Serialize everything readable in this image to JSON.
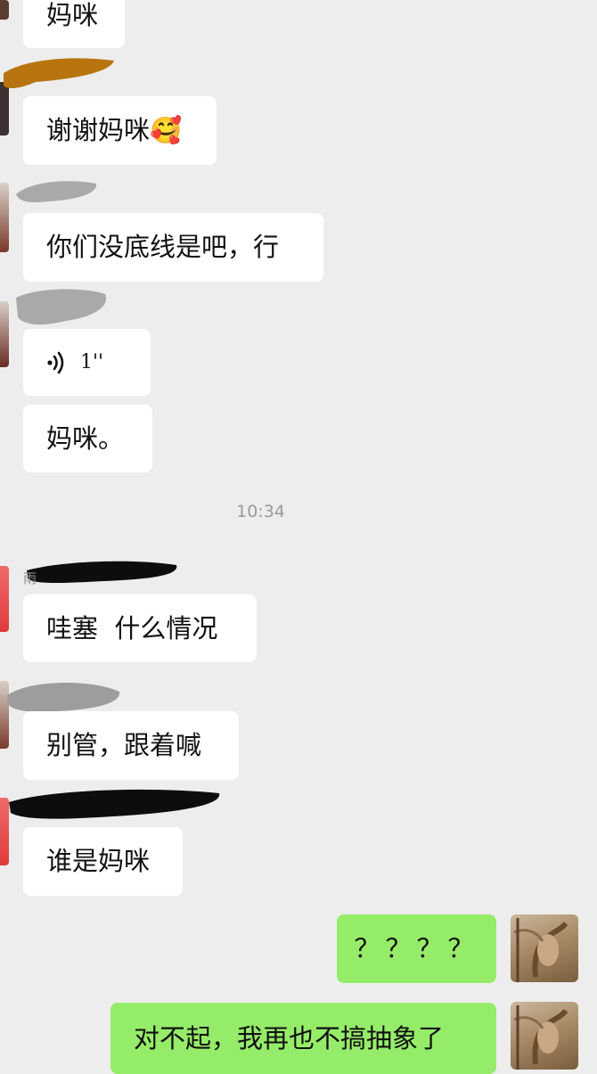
{
  "chat": {
    "messages": [
      {
        "sender": "other",
        "text": "妈咪"
      },
      {
        "sender": "other",
        "text": "谢谢妈咪🥰"
      },
      {
        "sender": "other",
        "text": "你们没底线是吧，行"
      },
      {
        "sender": "other",
        "type": "voice",
        "duration": "1''"
      },
      {
        "sender": "other",
        "text": "妈咪。"
      },
      {
        "sender": "other",
        "text": "哇塞  什么情况"
      },
      {
        "sender": "other",
        "text": "别管，跟着喊"
      },
      {
        "sender": "other",
        "text": "谁是妈咪"
      },
      {
        "sender": "me",
        "text": "？？？？"
      },
      {
        "sender": "me",
        "text": "对不起，我再也不搞抽象了"
      }
    ],
    "timestamp": "10:34",
    "partial_sender_char": "雨"
  },
  "colors": {
    "background": "#ededed",
    "incoming_bubble": "#ffffff",
    "outgoing_bubble": "#95ec69",
    "timestamp_text": "#9a9a9a"
  },
  "icons": {
    "voice": "voice-wave-icon"
  }
}
